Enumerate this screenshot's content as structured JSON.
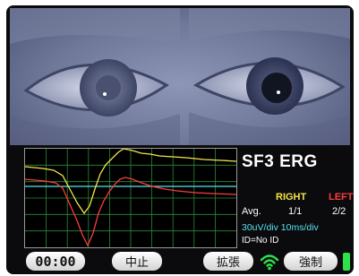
{
  "header": {
    "title": "SF3 ERG"
  },
  "legend": {
    "right_label": "RIGHT",
    "left_label": "LEFT",
    "avg_label": "Avg.",
    "avg_right": "1/1",
    "avg_left": "2/2",
    "scale_text": "30uV/div  10ms/div",
    "id_text": "ID=No ID"
  },
  "controls": {
    "timer": "00:00",
    "stop_label": "中止",
    "expand_label": "拡張",
    "force_label": "強制"
  },
  "colors": {
    "right_trace": "#f3e54a",
    "left_trace": "#ff3b3b",
    "baseline": "#58e4ee",
    "grid": "#2c8a3a",
    "battery": "#2ee14a"
  },
  "icons": {
    "wifi": "wifi-icon",
    "battery": "battery-icon"
  }
}
